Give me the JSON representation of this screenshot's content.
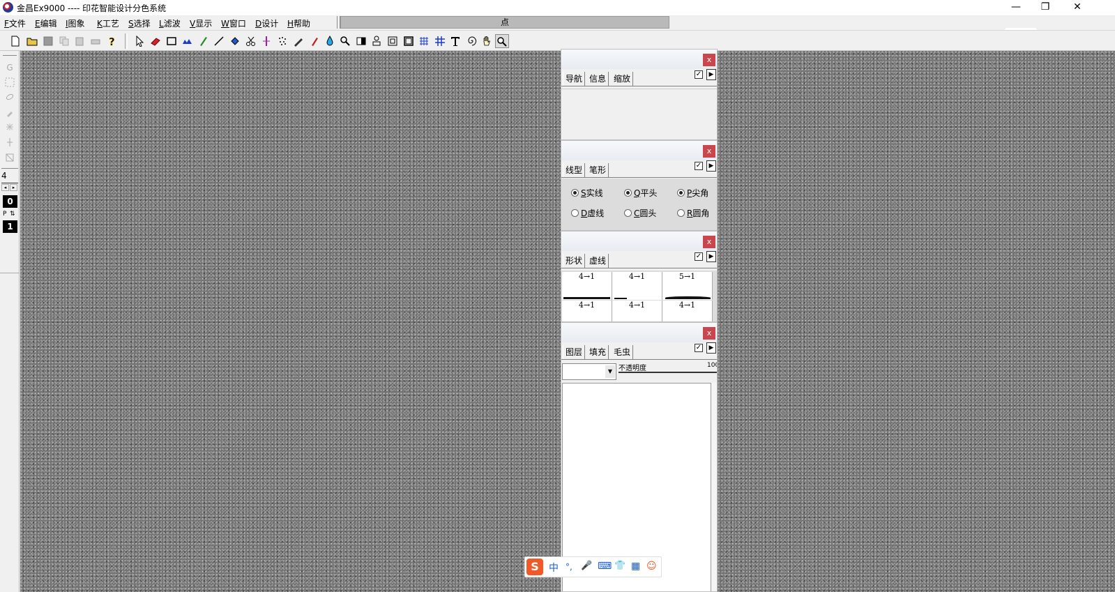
{
  "window": {
    "title": "金昌Ex9000 ---- 印花智能设计分色系统",
    "controls": {
      "minimize": "—",
      "maximize": "❐",
      "close": "✕"
    }
  },
  "menu": [
    {
      "key": "F",
      "label": "文件"
    },
    {
      "key": "E",
      "label": "编辑"
    },
    {
      "key": "I",
      "label": "图象"
    },
    {
      "key": "K",
      "label": "工艺"
    },
    {
      "key": "S",
      "label": "选择"
    },
    {
      "key": "L",
      "label": "滤波"
    },
    {
      "key": "V",
      "label": "显示"
    },
    {
      "key": "W",
      "label": "窗口"
    },
    {
      "key": "D",
      "label": "设计"
    },
    {
      "key": "H",
      "label": "帮助"
    }
  ],
  "status": {
    "text": "点"
  },
  "leftbar": {
    "size_value": "4",
    "counter_top": "0",
    "counter_label": "P",
    "counter_bottom": "1"
  },
  "panels": {
    "navigator": {
      "close": "x",
      "tabs": [
        "导航",
        "信息",
        "缩放"
      ]
    },
    "linetype": {
      "close": "x",
      "tabs": [
        "线型",
        "笔形"
      ],
      "row1": [
        {
          "key": "S",
          "label": "实线"
        },
        {
          "key": "Q",
          "label": "平头"
        },
        {
          "key": "P",
          "label": "尖角"
        }
      ],
      "row2": [
        {
          "key": "D",
          "label": "虚线"
        },
        {
          "key": "C",
          "label": "圆头"
        },
        {
          "key": "R",
          "label": "圆角"
        }
      ]
    },
    "shape": {
      "close": "x",
      "tabs": [
        "形状",
        "虚线"
      ],
      "cells": [
        "4→1",
        "4→1",
        "5→1",
        "4→1",
        "4→1",
        "4→1"
      ]
    },
    "layers": {
      "close": "x",
      "tabs": [
        "图层",
        "填充",
        "毛虫"
      ],
      "opacity_label": "不透明度",
      "opacity_value": "100"
    }
  },
  "ime": {
    "items": [
      "S",
      "中",
      "°,",
      "🎤",
      "⌨",
      "👕",
      "▦",
      "☺"
    ]
  }
}
